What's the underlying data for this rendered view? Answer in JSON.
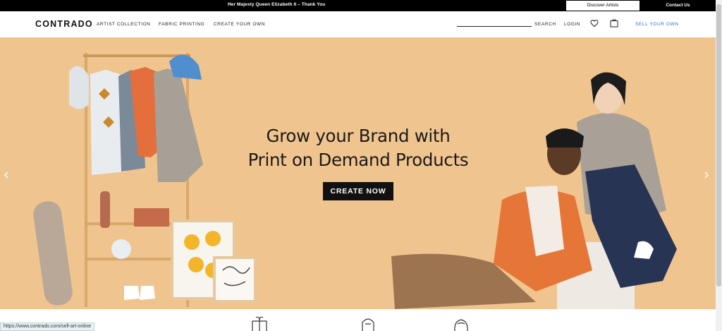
{
  "announcement": {
    "message": "Her Majesty Queen Elizabeth II – Thank You",
    "discover_label": "Discover Artists",
    "contact_label": "Contact Us"
  },
  "header": {
    "logo": "CONTRADO",
    "nav": [
      "ARTIST COLLECTION",
      "FABRIC PRINTING",
      "CREATE YOUR OWN"
    ],
    "search_label": "SEARCH",
    "login_label": "LOGIN",
    "sell_label": "SELL YOUR OWN"
  },
  "hero": {
    "headline_line1": "Grow your Brand with",
    "headline_line2": "Print on Demand Products",
    "cta_label": "CREATE NOW"
  },
  "status_url": "https://www.contrado.com/sell-art-online",
  "colors": {
    "hero_bg": "#f0c48e",
    "accent": "#2b6fd6",
    "bar": "#000000"
  },
  "icons": [
    "heart-icon",
    "shopping-bag-icon",
    "chevron-left-icon",
    "chevron-right-icon"
  ]
}
